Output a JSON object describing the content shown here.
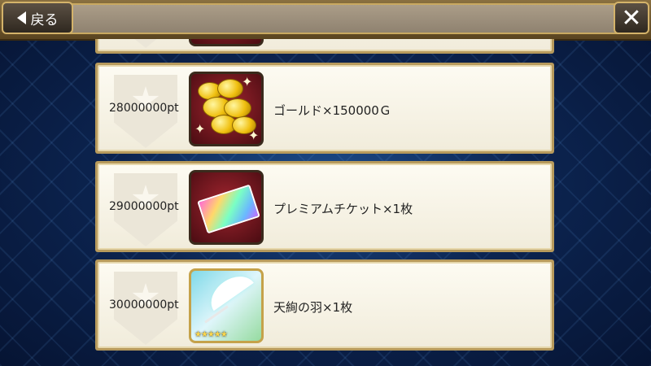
{
  "header": {
    "back_label": "戻る",
    "close_label": "✕"
  },
  "rewards": [
    {
      "points": "28000000pt",
      "item": "ゴールド×150000Ｇ",
      "icon": "gold-coins-icon"
    },
    {
      "points": "29000000pt",
      "item": "プレミアムチケット×1枚",
      "icon": "premium-ticket-icon"
    },
    {
      "points": "30000000pt",
      "item": "天絢の羽×1枚",
      "icon": "feather-icon",
      "rarity_stars": "★★★★★"
    }
  ],
  "colors": {
    "frame_gold": "#b79a5c",
    "row_bg": "#fdfbf2",
    "icon_bg_red": "#a2252f"
  }
}
